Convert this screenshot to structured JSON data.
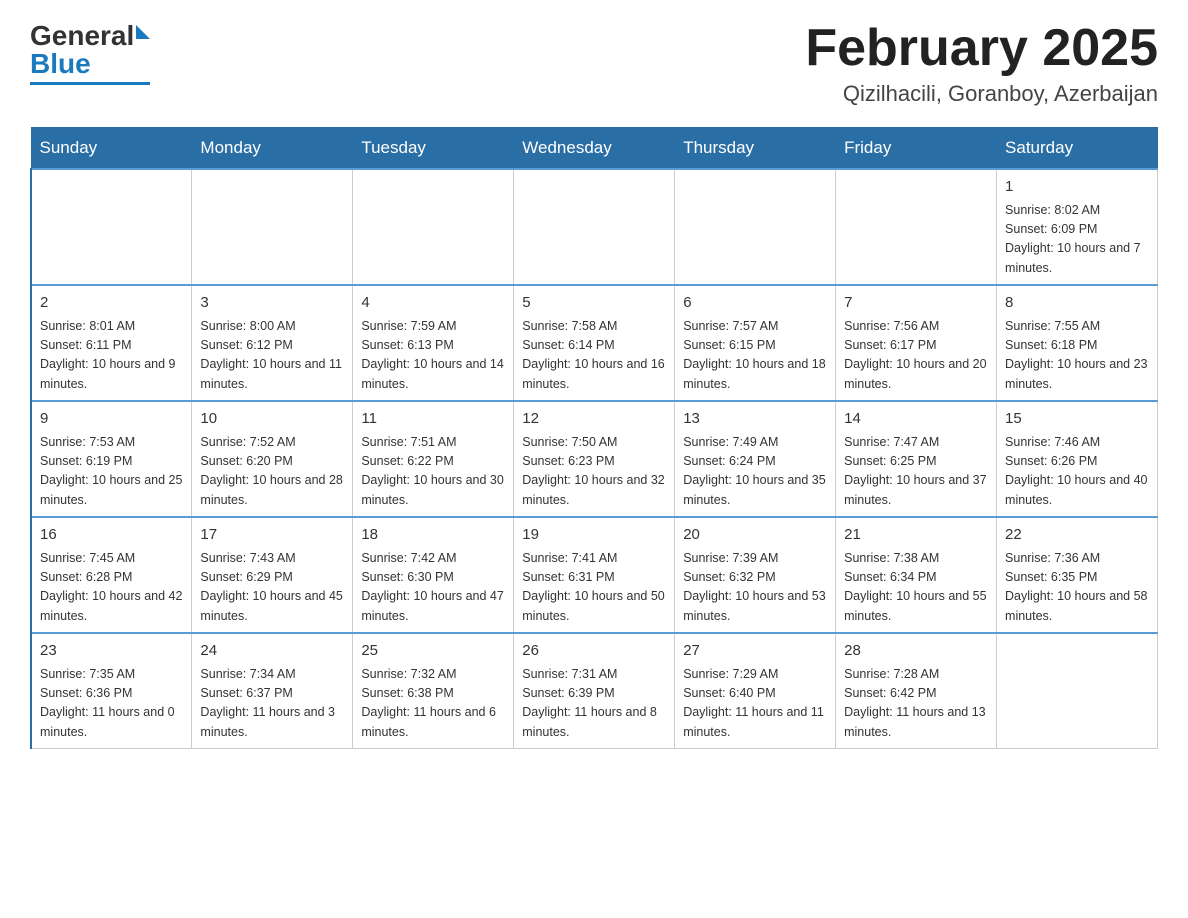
{
  "header": {
    "logo": {
      "general": "General",
      "blue": "Blue"
    },
    "title": "February 2025",
    "location": "Qizilhacili, Goranboy, Azerbaijan"
  },
  "days_of_week": [
    "Sunday",
    "Monday",
    "Tuesday",
    "Wednesday",
    "Thursday",
    "Friday",
    "Saturday"
  ],
  "weeks": [
    {
      "days": [
        {
          "num": "",
          "info": ""
        },
        {
          "num": "",
          "info": ""
        },
        {
          "num": "",
          "info": ""
        },
        {
          "num": "",
          "info": ""
        },
        {
          "num": "",
          "info": ""
        },
        {
          "num": "",
          "info": ""
        },
        {
          "num": "1",
          "info": "Sunrise: 8:02 AM\nSunset: 6:09 PM\nDaylight: 10 hours and 7 minutes."
        }
      ]
    },
    {
      "days": [
        {
          "num": "2",
          "info": "Sunrise: 8:01 AM\nSunset: 6:11 PM\nDaylight: 10 hours and 9 minutes."
        },
        {
          "num": "3",
          "info": "Sunrise: 8:00 AM\nSunset: 6:12 PM\nDaylight: 10 hours and 11 minutes."
        },
        {
          "num": "4",
          "info": "Sunrise: 7:59 AM\nSunset: 6:13 PM\nDaylight: 10 hours and 14 minutes."
        },
        {
          "num": "5",
          "info": "Sunrise: 7:58 AM\nSunset: 6:14 PM\nDaylight: 10 hours and 16 minutes."
        },
        {
          "num": "6",
          "info": "Sunrise: 7:57 AM\nSunset: 6:15 PM\nDaylight: 10 hours and 18 minutes."
        },
        {
          "num": "7",
          "info": "Sunrise: 7:56 AM\nSunset: 6:17 PM\nDaylight: 10 hours and 20 minutes."
        },
        {
          "num": "8",
          "info": "Sunrise: 7:55 AM\nSunset: 6:18 PM\nDaylight: 10 hours and 23 minutes."
        }
      ]
    },
    {
      "days": [
        {
          "num": "9",
          "info": "Sunrise: 7:53 AM\nSunset: 6:19 PM\nDaylight: 10 hours and 25 minutes."
        },
        {
          "num": "10",
          "info": "Sunrise: 7:52 AM\nSunset: 6:20 PM\nDaylight: 10 hours and 28 minutes."
        },
        {
          "num": "11",
          "info": "Sunrise: 7:51 AM\nSunset: 6:22 PM\nDaylight: 10 hours and 30 minutes."
        },
        {
          "num": "12",
          "info": "Sunrise: 7:50 AM\nSunset: 6:23 PM\nDaylight: 10 hours and 32 minutes."
        },
        {
          "num": "13",
          "info": "Sunrise: 7:49 AM\nSunset: 6:24 PM\nDaylight: 10 hours and 35 minutes."
        },
        {
          "num": "14",
          "info": "Sunrise: 7:47 AM\nSunset: 6:25 PM\nDaylight: 10 hours and 37 minutes."
        },
        {
          "num": "15",
          "info": "Sunrise: 7:46 AM\nSunset: 6:26 PM\nDaylight: 10 hours and 40 minutes."
        }
      ]
    },
    {
      "days": [
        {
          "num": "16",
          "info": "Sunrise: 7:45 AM\nSunset: 6:28 PM\nDaylight: 10 hours and 42 minutes."
        },
        {
          "num": "17",
          "info": "Sunrise: 7:43 AM\nSunset: 6:29 PM\nDaylight: 10 hours and 45 minutes."
        },
        {
          "num": "18",
          "info": "Sunrise: 7:42 AM\nSunset: 6:30 PM\nDaylight: 10 hours and 47 minutes."
        },
        {
          "num": "19",
          "info": "Sunrise: 7:41 AM\nSunset: 6:31 PM\nDaylight: 10 hours and 50 minutes."
        },
        {
          "num": "20",
          "info": "Sunrise: 7:39 AM\nSunset: 6:32 PM\nDaylight: 10 hours and 53 minutes."
        },
        {
          "num": "21",
          "info": "Sunrise: 7:38 AM\nSunset: 6:34 PM\nDaylight: 10 hours and 55 minutes."
        },
        {
          "num": "22",
          "info": "Sunrise: 7:36 AM\nSunset: 6:35 PM\nDaylight: 10 hours and 58 minutes."
        }
      ]
    },
    {
      "days": [
        {
          "num": "23",
          "info": "Sunrise: 7:35 AM\nSunset: 6:36 PM\nDaylight: 11 hours and 0 minutes."
        },
        {
          "num": "24",
          "info": "Sunrise: 7:34 AM\nSunset: 6:37 PM\nDaylight: 11 hours and 3 minutes."
        },
        {
          "num": "25",
          "info": "Sunrise: 7:32 AM\nSunset: 6:38 PM\nDaylight: 11 hours and 6 minutes."
        },
        {
          "num": "26",
          "info": "Sunrise: 7:31 AM\nSunset: 6:39 PM\nDaylight: 11 hours and 8 minutes."
        },
        {
          "num": "27",
          "info": "Sunrise: 7:29 AM\nSunset: 6:40 PM\nDaylight: 11 hours and 11 minutes."
        },
        {
          "num": "28",
          "info": "Sunrise: 7:28 AM\nSunset: 6:42 PM\nDaylight: 11 hours and 13 minutes."
        },
        {
          "num": "",
          "info": ""
        }
      ]
    }
  ]
}
